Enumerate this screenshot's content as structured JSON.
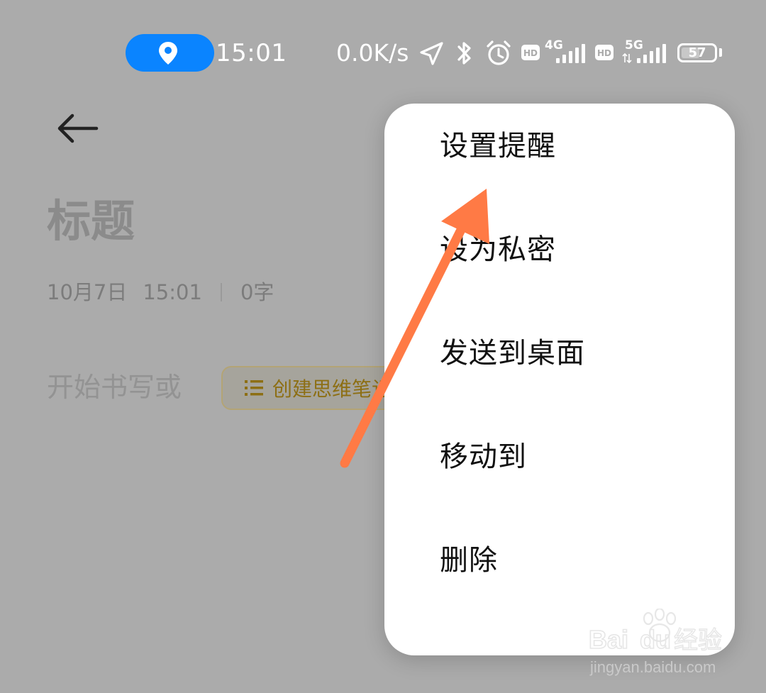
{
  "status_bar": {
    "time": "15:01",
    "net_speed": "0.0K/s",
    "sim1_network": "4G",
    "sim2_network": "5G",
    "hd_badge": "HD",
    "battery_level": "57",
    "location_pill_color": "#0a84ff"
  },
  "note": {
    "back_icon": "back-arrow-icon",
    "title_placeholder": "标题",
    "date": "10月7日",
    "time": "15:01",
    "word_count": "0字",
    "body_placeholder": "开始书写或",
    "mindmap_button_label": "创建思维笔记",
    "mindmap_accent_color": "#8d6f14"
  },
  "menu": {
    "items": [
      {
        "label": "设置提醒"
      },
      {
        "label": "设为私密"
      },
      {
        "label": "发送到桌面"
      },
      {
        "label": "移动到"
      },
      {
        "label": "删除"
      }
    ]
  },
  "annotation": {
    "arrow_color": "#ff7a45",
    "arrow_target": "设置提醒"
  },
  "watermark": {
    "logo_text": "Bai du 经验",
    "url": "jingyan.baidu.com"
  }
}
